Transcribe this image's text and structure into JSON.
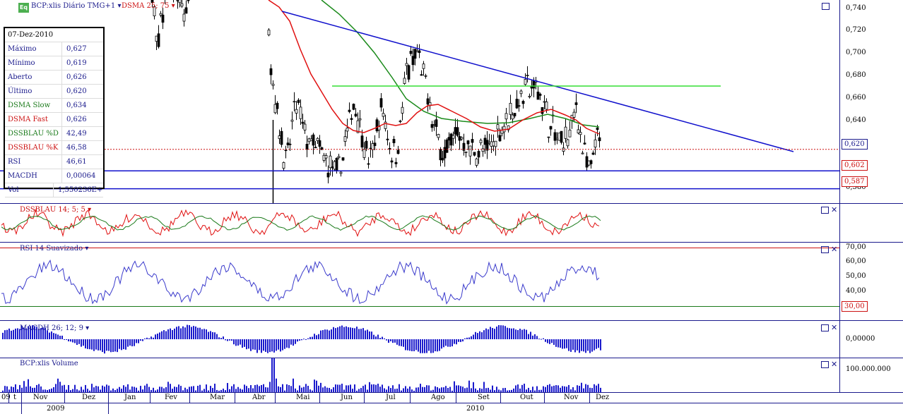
{
  "header": {
    "logo_text": "Eq",
    "symbol_label": "BCP:xlis Diário TMG+1 ▾",
    "dsma_label": "DSMA 25; 75 ▾"
  },
  "info_box": {
    "date": "07-Dez-2010",
    "rows": [
      {
        "label": "Máximo",
        "value": "0,627",
        "color": "#1a1a8c"
      },
      {
        "label": "Mínimo",
        "value": "0,619",
        "color": "#1a1a8c"
      },
      {
        "label": "Aberto",
        "value": "0,626",
        "color": "#1a1a8c"
      },
      {
        "label": "Último",
        "value": "0,620",
        "color": "#1a1a8c"
      },
      {
        "label": "DSMA Slow",
        "value": "0,634",
        "color": "#1a7a1a"
      },
      {
        "label": "DSMA Fast",
        "value": "0,626",
        "color": "#cc1111"
      },
      {
        "label": "DSSBLAU %D",
        "value": "42,49",
        "color": "#1a7a1a"
      },
      {
        "label": "DSSBLAU %K",
        "value": "46,58",
        "color": "#cc1111"
      },
      {
        "label": "RSI",
        "value": "46,61",
        "color": "#1a1a8c"
      },
      {
        "label": "MACDH",
        "value": "0,00064",
        "color": "#1a1a8c"
      },
      {
        "label": "Vol",
        "value": "1,550236E+07",
        "color": "#1a1a8c"
      }
    ]
  },
  "panels": {
    "dssblau_title": "DSSBLAU 14; 5; 5 ▾",
    "rsi_title": "RSI 14 Suavizado ▾",
    "macdh_title": "MACDH 26; 12; 9 ▾",
    "volume_title": "BCP:xlis Volume"
  },
  "price_axis": {
    "ticks": [
      "0,740",
      "0,720",
      "0,700",
      "0,680",
      "0,660",
      "0,640",
      "0,620",
      "0,600",
      "0,580"
    ],
    "last_price_tag": "0,620",
    "support_tag_1": "0,602",
    "support_tag_2": "0,587"
  },
  "rsi_axis": {
    "ticks": [
      "70,00",
      "60,00",
      "50,00",
      "40,00",
      "30,00"
    ],
    "level_tag": "30,00"
  },
  "macdh_axis": {
    "tick": "0,00000"
  },
  "volume_axis": {
    "tick": "100.000.000"
  },
  "time_axis": {
    "months": [
      "Nov",
      "Dez",
      "Jan",
      "Fev",
      "Mar",
      "Abr",
      "Mai",
      "Jun",
      "Jul",
      "Ago",
      "Set",
      "Out",
      "Nov",
      "Dez"
    ],
    "years": [
      "2009",
      "2010"
    ],
    "left_fragment": "09",
    "left_fragment2": "t"
  },
  "colors": {
    "axis_blue": "#1a1a8c",
    "dsma_fast": "#e01010",
    "dsma_slow": "#1a8a1a",
    "trendline": "#1010cc",
    "resistance": "#33dd33",
    "last_price_dotted": "#cc1111"
  },
  "chart_data": {
    "type": "line",
    "title": "BCP:xlis Diário TMG+1",
    "price_axis_range": [
      0.575,
      0.745
    ],
    "trendline": {
      "from": [
        "Abr",
        0.737
      ],
      "to": [
        "Dez",
        0.612
      ]
    },
    "resistance_level": 0.673,
    "support_levels": [
      0.602,
      0.587
    ],
    "last_price": 0.62,
    "dsma_fast_last": 0.626,
    "dsma_slow_last": 0.634,
    "indicators": {
      "dssblau": {
        "params": "14; 5; 5",
        "pct_d": 42.49,
        "pct_k": 46.58
      },
      "rsi": {
        "params": "14",
        "value": 46.61,
        "axis": [
          30,
          70
        ],
        "level": 30
      },
      "macdh": {
        "params": "26; 12; 9",
        "value": 0.00064
      },
      "volume": {
        "value": 15502360
      }
    }
  }
}
